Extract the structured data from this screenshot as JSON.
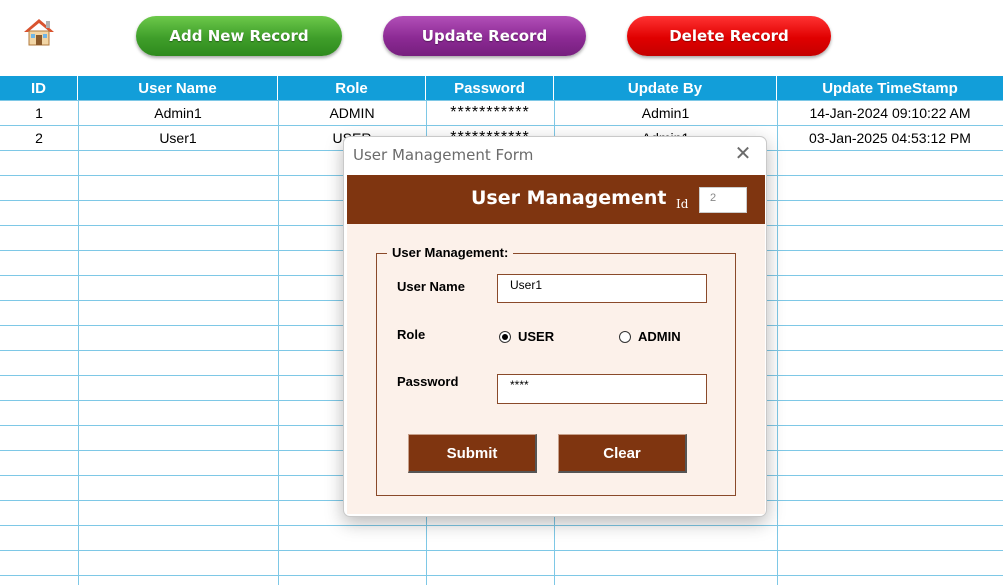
{
  "toolbar": {
    "home_icon": "house-icon",
    "add_label": "Add New Record",
    "update_label": "Update Record",
    "delete_label": "Delete Record",
    "colors": {
      "add": "#3f9e2a",
      "update": "#8c2a94",
      "delete": "#e00000"
    }
  },
  "table": {
    "header_color": "#129ed9",
    "columns": [
      "ID",
      "User Name",
      "Role",
      "Password",
      "Update By",
      "Update TimeStamp"
    ],
    "rows": [
      {
        "id": "1",
        "user_name": "Admin1",
        "role": "ADMIN",
        "password": "***********",
        "update_by": "Admin1",
        "timestamp": "14-Jan-2024 09:10:22 AM"
      },
      {
        "id": "2",
        "user_name": "User1",
        "role": "USER",
        "password": "***********",
        "update_by": "Admin1",
        "timestamp": "03-Jan-2025 04:53:12 PM"
      }
    ]
  },
  "dialog": {
    "window_title": "User Management Form",
    "close_icon": "close-icon",
    "header_title": "User Management",
    "id_label": "Id",
    "id_value": "2",
    "group_label": "User Management:",
    "user_name_label": "User Name",
    "user_name_value": "User1",
    "role_label": "Role",
    "role_options": [
      "USER",
      "ADMIN"
    ],
    "role_selected": "USER",
    "password_label": "Password",
    "password_value": "****",
    "submit_label": "Submit",
    "clear_label": "Clear",
    "accent_color": "#7f3510"
  }
}
